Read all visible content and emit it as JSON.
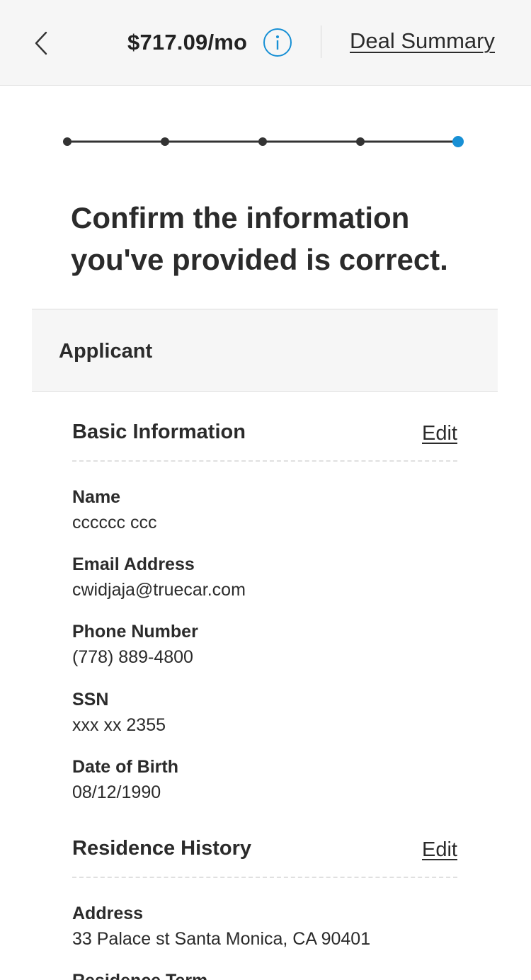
{
  "header": {
    "price": "$717.09/mo",
    "info_icon": "info-icon",
    "deal_summary": "Deal Summary",
    "accent_color": "#1890d5"
  },
  "progress": {
    "total_steps": 5,
    "current_step": 5
  },
  "page_title": "Confirm the information you've provided is correct.",
  "applicant": {
    "section_label": "Applicant",
    "basic_information": {
      "title": "Basic Information",
      "edit_label": "Edit",
      "fields": [
        {
          "label": "Name",
          "value": "cccccc ccc"
        },
        {
          "label": "Email Address",
          "value": "cwidjaja@truecar.com"
        },
        {
          "label": "Phone Number",
          "value": "(778) 889-4800"
        },
        {
          "label": "SSN",
          "value": "xxx xx 2355"
        },
        {
          "label": "Date of Birth",
          "value": "08/12/1990"
        }
      ]
    },
    "residence_history": {
      "title": "Residence History",
      "edit_label": "Edit",
      "fields": [
        {
          "label": "Address",
          "value": "33 Palace st Santa Monica, CA 90401"
        },
        {
          "label": "Residence Term",
          "value": ""
        }
      ]
    }
  }
}
